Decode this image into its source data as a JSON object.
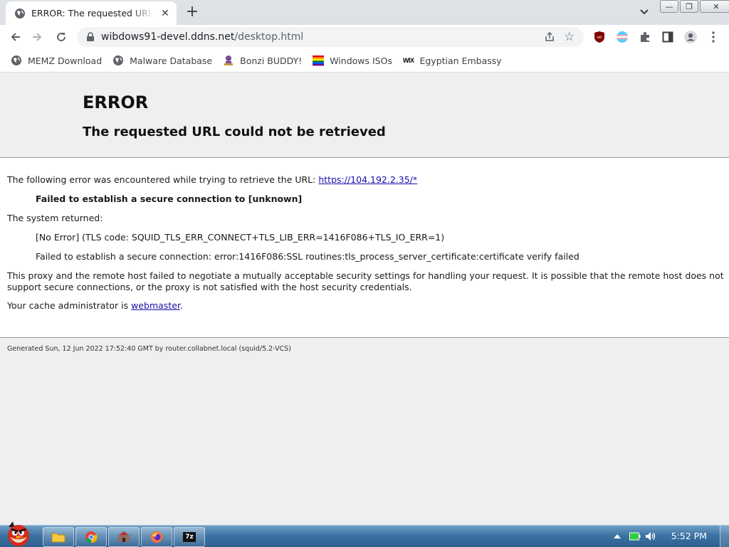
{
  "browser": {
    "tab": {
      "title": "ERROR: The requested URL could not be retrieved",
      "close": "✕"
    },
    "new_tab": "+",
    "window_controls": {
      "minimize": "—",
      "restore": "❐",
      "close": "✕"
    },
    "address": {
      "host": "wibdows91-devel.ddns.net",
      "path": "/desktop.html"
    },
    "bookmarks": [
      {
        "label": "MEMZ Download",
        "icon": "globe-icon"
      },
      {
        "label": "Malware Database",
        "icon": "globe-icon"
      },
      {
        "label": "Bonzi BUDDY!",
        "icon": "bonzi-icon"
      },
      {
        "label": "Windows ISOs",
        "icon": "rainbow-flag-icon"
      },
      {
        "label": "Egyptian Embassy",
        "icon": "wix-icon",
        "icon_text": "WIX"
      }
    ],
    "extensions": [
      "ublock-icon",
      "trans-flag-icon",
      "puzzle-icon",
      "sidebar-icon",
      "profile-icon"
    ]
  },
  "page": {
    "title": "ERROR",
    "subtitle": "The requested URL could not be retrieved",
    "intro": "The following error was encountered while trying to retrieve the URL:",
    "intro_link": "https://104.192.2.35/*",
    "failed": "Failed to establish a secure connection to [unknown]",
    "system_returned": "The system returned:",
    "code_line": "[No Error] (TLS code: SQUID_TLS_ERR_CONNECT+TLS_LIB_ERR=1416F086+TLS_IO_ERR=1)",
    "detail_line": "Failed to establish a secure connection: error:1416F086:SSL routines:tls_process_server_certificate:certificate verify failed",
    "explain_1": "This proxy and the remote host failed to negotiate a mutually acceptable security settings for handling your request. It is possible that the remote host does not",
    "explain_2": "support secure connections, or the proxy is not satisfied with the host security credentials.",
    "admin_prefix": "Your cache administrator is ",
    "admin_link": "webmaster",
    "admin_suffix": ".",
    "generated": "Generated Sun, 12 Jun 2022 17:52:40 GMT by router.collabnet.local (squid/5.2-VCS)"
  },
  "taskbar": {
    "clock": "5:52 PM",
    "buttons": [
      "explorer-icon",
      "chrome-icon",
      "app-icon",
      "firefox-icon",
      "7zip-icon"
    ],
    "sevenzip_label": "7z"
  },
  "colors": {
    "link": "#1a0dab",
    "taskbar": "#3d73a3",
    "tab_strip": "#dee1e6"
  }
}
